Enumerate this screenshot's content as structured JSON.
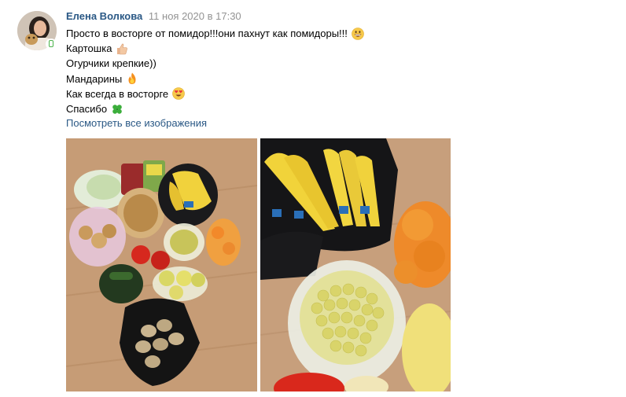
{
  "post": {
    "author": "Елена Волкова",
    "date": "11 ноя 2020 в 17:30",
    "lines": [
      {
        "text": "Просто в восторге от помидор!!!они пахнут как помидоры!!!",
        "emoji": "grinning-face-icon"
      },
      {
        "text": "Картошка",
        "emoji": "thumbs-up-icon"
      },
      {
        "text": "Огурчики крепкие))",
        "emoji": null
      },
      {
        "text": "Мандарины",
        "emoji": "fire-icon"
      },
      {
        "text": "Как всегда в восторге",
        "emoji": "heart-eyes-icon"
      },
      {
        "text": "Спасибо",
        "emoji": "four-leaf-clover-icon"
      }
    ],
    "show_all_images": "Посмотреть все изображения"
  },
  "colors": {
    "link": "#2a5885",
    "date": "#939393",
    "online": "#4bb34b"
  }
}
